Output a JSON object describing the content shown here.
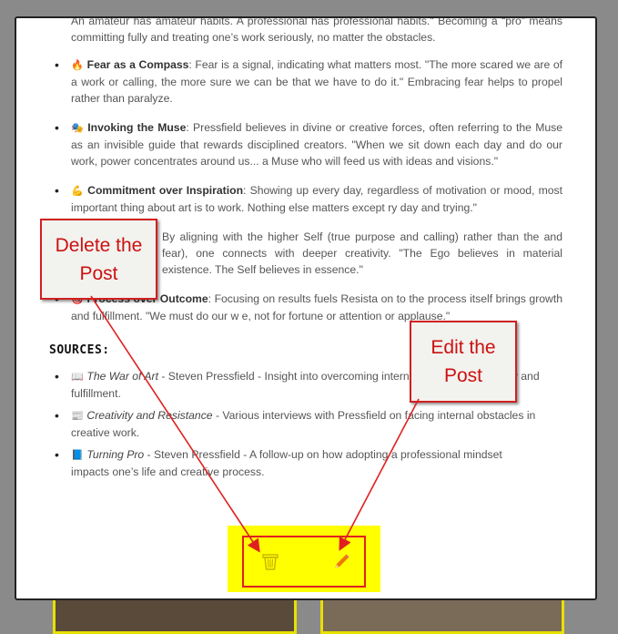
{
  "intro": {
    "line1": "An amateur has amateur habits. A professional has professional habits.\" Becoming a “pro” means committing fully and treating one’s work seriously, no matter the obstacles."
  },
  "principles": [
    {
      "emoji": "🔥",
      "title": "Fear as a Compass",
      "text": ": Fear is a signal, indicating what matters most. \"The more scared we are of a work or calling, the more sure we can be that we have to do it.\" Embracing fear helps to propel rather than paralyze."
    },
    {
      "emoji": "🎭",
      "title": "Invoking the Muse",
      "text": ": Pressfield believes in divine or creative forces, often referring to the Muse as an invisible guide that rewards disciplined creators. \"When we sit down each day and do our work, power concentrates around us... a Muse who will feed us with ideas and visions.\""
    },
    {
      "emoji": "💪",
      "title": "Commitment over Inspiration",
      "text": ": Showing up every day, regardless of motivation or mood, most important thing about art is to work. Nothing else matters except ry day and trying.\""
    },
    {
      "emoji": "",
      "title": "",
      "text": "By aligning with the higher Self (true purpose and calling) rather than the and fear), one connects with deeper creativity. \"The Ego believes in material existence. The Self believes in essence.\""
    },
    {
      "emoji": "🎯",
      "title": "Process over Outcome",
      "text": ": Focusing on results fuels Resista on to the process itself brings growth and fulfillment. \"We must do our w e, not for fortune or attention or applause.\""
    }
  ],
  "sources": {
    "heading": "SOURCES:",
    "items": [
      {
        "emoji": "📖",
        "title": "The War of Art",
        "text": " - Steven Pressfield - Insight into overcoming internal barriers to creativity and fulfillment."
      },
      {
        "emoji": "📰",
        "title": "Creativity and Resistance",
        "text": " - Various interviews with Pressfield on facing internal obstacles in creative work."
      },
      {
        "emoji": "📘",
        "title": "Turning Pro",
        "text": " - Steven Pressfield - A follow-up on how adopting a professional mindset impacts one’s life and creative process."
      }
    ]
  },
  "actions": {
    "delete_icon": "trash-icon",
    "edit_icon": "pencil-icon"
  },
  "annotations": {
    "delete_callout": "Delete the Post",
    "edit_callout": "Edit the Post"
  },
  "colors": {
    "highlight": "#ffff00",
    "annotation_red": "#e02020",
    "pencil": "#f07800",
    "trash": "#c8b400"
  }
}
